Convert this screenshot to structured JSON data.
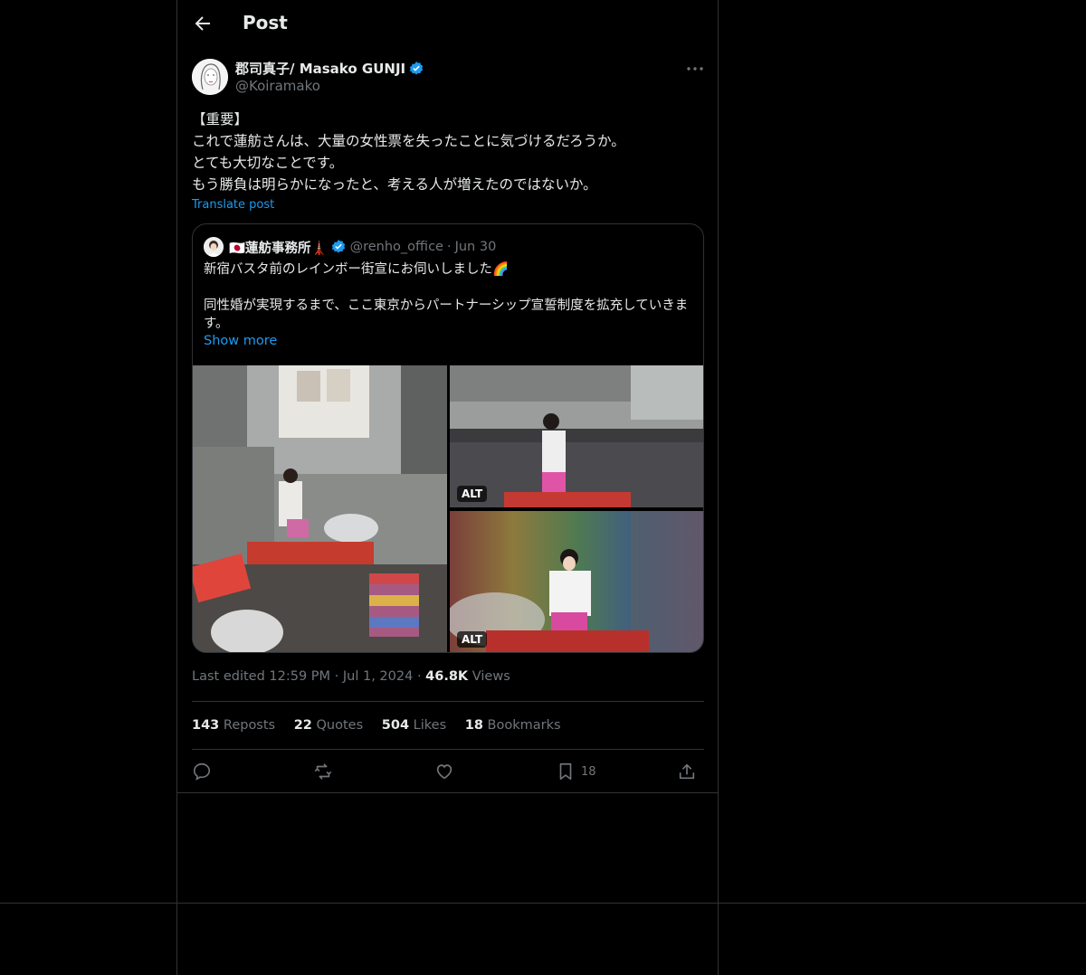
{
  "header": {
    "title": "Post",
    "back_icon": "arrow-left-icon"
  },
  "author": {
    "name": "郡司真子/ Masako GUNJI",
    "handle": "@Koiramako",
    "verified": true
  },
  "post": {
    "lines": [
      "【重要】",
      "これで蓮舫さんは、大量の女性票を失ったことに気づけるだろうか。",
      "とても大切なことです。",
      "もう勝負は明らかになったと、考える人が増えたのではないか。"
    ],
    "translate_label": "Translate post"
  },
  "quote": {
    "name": "🇯🇵蓮舫事務所🗼",
    "handle": "@renho_office",
    "date_sep": "·",
    "date": "Jun 30",
    "line1": "新宿バスタ前のレインボー街宣にお伺いしました🌈",
    "line2": "同性婚が実現するまで、ここ東京からパートナーシップ宣誓制度を拡充していきます。",
    "show_more": "Show more",
    "alt_label": "ALT"
  },
  "meta": {
    "edited": "Last edited 12:59 PM",
    "date": "Jul 1, 2024",
    "views_count": "46.8K",
    "views_label": "Views"
  },
  "stats": {
    "reposts_count": "143",
    "reposts_label": "Reposts",
    "quotes_count": "22",
    "quotes_label": "Quotes",
    "likes_count": "504",
    "likes_label": "Likes",
    "bookmarks_count": "18",
    "bookmarks_label": "Bookmarks"
  },
  "actions": {
    "bookmark_count": "18"
  },
  "colors": {
    "background": "#000000",
    "accent": "#1d9bf0",
    "muted": "#71767b",
    "border": "#2f3336"
  }
}
